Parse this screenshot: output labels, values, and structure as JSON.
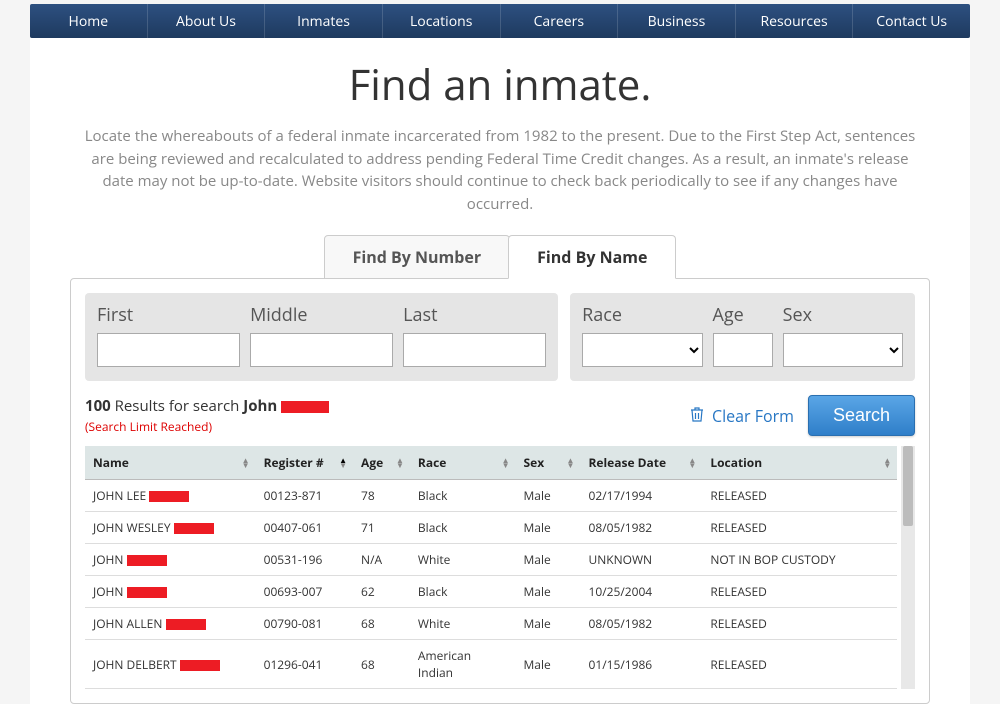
{
  "nav": [
    "Home",
    "About Us",
    "Inmates",
    "Locations",
    "Careers",
    "Business",
    "Resources",
    "Contact Us"
  ],
  "page": {
    "title": "Find an inmate.",
    "intro": "Locate the whereabouts of a federal inmate incarcerated from 1982 to the present. Due to the First Step Act, sentences are being reviewed and recalculated to address pending Federal Time Credit changes. As a result, an inmate's release date may not be up-to-date. Website visitors should continue to check back periodically to see if any changes have occurred."
  },
  "tabs": {
    "by_number": "Find By Number",
    "by_name": "Find By Name"
  },
  "fields": {
    "first": "First",
    "middle": "Middle",
    "last": "Last",
    "race": "Race",
    "age": "Age",
    "sex": "Sex"
  },
  "results": {
    "count": "100",
    "label_mid": " Results for search ",
    "search_term": "John",
    "limit": "(Search Limit Reached)",
    "clear": "Clear Form",
    "search_btn": "Search"
  },
  "columns": {
    "name": "Name",
    "register": "Register #",
    "age": "Age",
    "race": "Race",
    "sex": "Sex",
    "release": "Release Date",
    "location": "Location"
  },
  "rows": [
    {
      "name": "JOHN LEE",
      "register": "00123-871",
      "age": "78",
      "race": "Black",
      "sex": "Male",
      "release": "02/17/1994",
      "location": "RELEASED"
    },
    {
      "name": "JOHN WESLEY",
      "register": "00407-061",
      "age": "71",
      "race": "Black",
      "sex": "Male",
      "release": "08/05/1982",
      "location": "RELEASED"
    },
    {
      "name": "JOHN",
      "register": "00531-196",
      "age": "N/A",
      "race": "White",
      "sex": "Male",
      "release": "UNKNOWN",
      "location": "NOT IN BOP CUSTODY"
    },
    {
      "name": "JOHN",
      "register": "00693-007",
      "age": "62",
      "race": "Black",
      "sex": "Male",
      "release": "10/25/2004",
      "location": "RELEASED"
    },
    {
      "name": "JOHN ALLEN",
      "register": "00790-081",
      "age": "68",
      "race": "White",
      "sex": "Male",
      "release": "08/05/1982",
      "location": "RELEASED"
    },
    {
      "name": "JOHN DELBERT",
      "register": "01296-041",
      "age": "68",
      "race": "American Indian",
      "sex": "Male",
      "release": "01/15/1986",
      "location": "RELEASED"
    }
  ]
}
